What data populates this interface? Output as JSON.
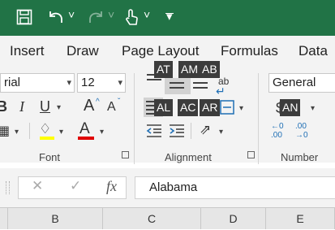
{
  "qat": {
    "undo_arrow": "˅",
    "redo_arrow": "˅",
    "touch_arrow": "˅",
    "customize": "▾"
  },
  "tabs": [
    {
      "label": "Insert"
    },
    {
      "label": "Draw"
    },
    {
      "label": "Page Layout"
    },
    {
      "label": "Formulas"
    },
    {
      "label": "Data"
    }
  ],
  "font": {
    "name_value": "rial",
    "size_value": "12",
    "bold": "B",
    "italic": "I",
    "underline": "U",
    "grow": "A",
    "shrink": "A",
    "font_color": "A",
    "group_label": "Font"
  },
  "alignment": {
    "keytips": [
      "AT",
      "AM",
      "AB",
      "AL",
      "AC",
      "AR"
    ],
    "group_label": "Alignment",
    "wrap_label": "ab"
  },
  "number": {
    "format_value": "General",
    "keytip": "AN",
    "currency": "$",
    "increase_decimal": ".00",
    "decrease_decimal": ".00",
    "group_label": "Number"
  },
  "formula_bar": {
    "cancel": "✕",
    "enter": "✓",
    "fx": "fx",
    "content": "Alabama"
  },
  "columns": [
    "B",
    "C",
    "D",
    "E"
  ],
  "colors": {
    "title_bg": "#217346",
    "ribbon_bg": "#f3f3f3",
    "keytip_bg": "#3c3c3c",
    "font_red": "#e00000"
  }
}
